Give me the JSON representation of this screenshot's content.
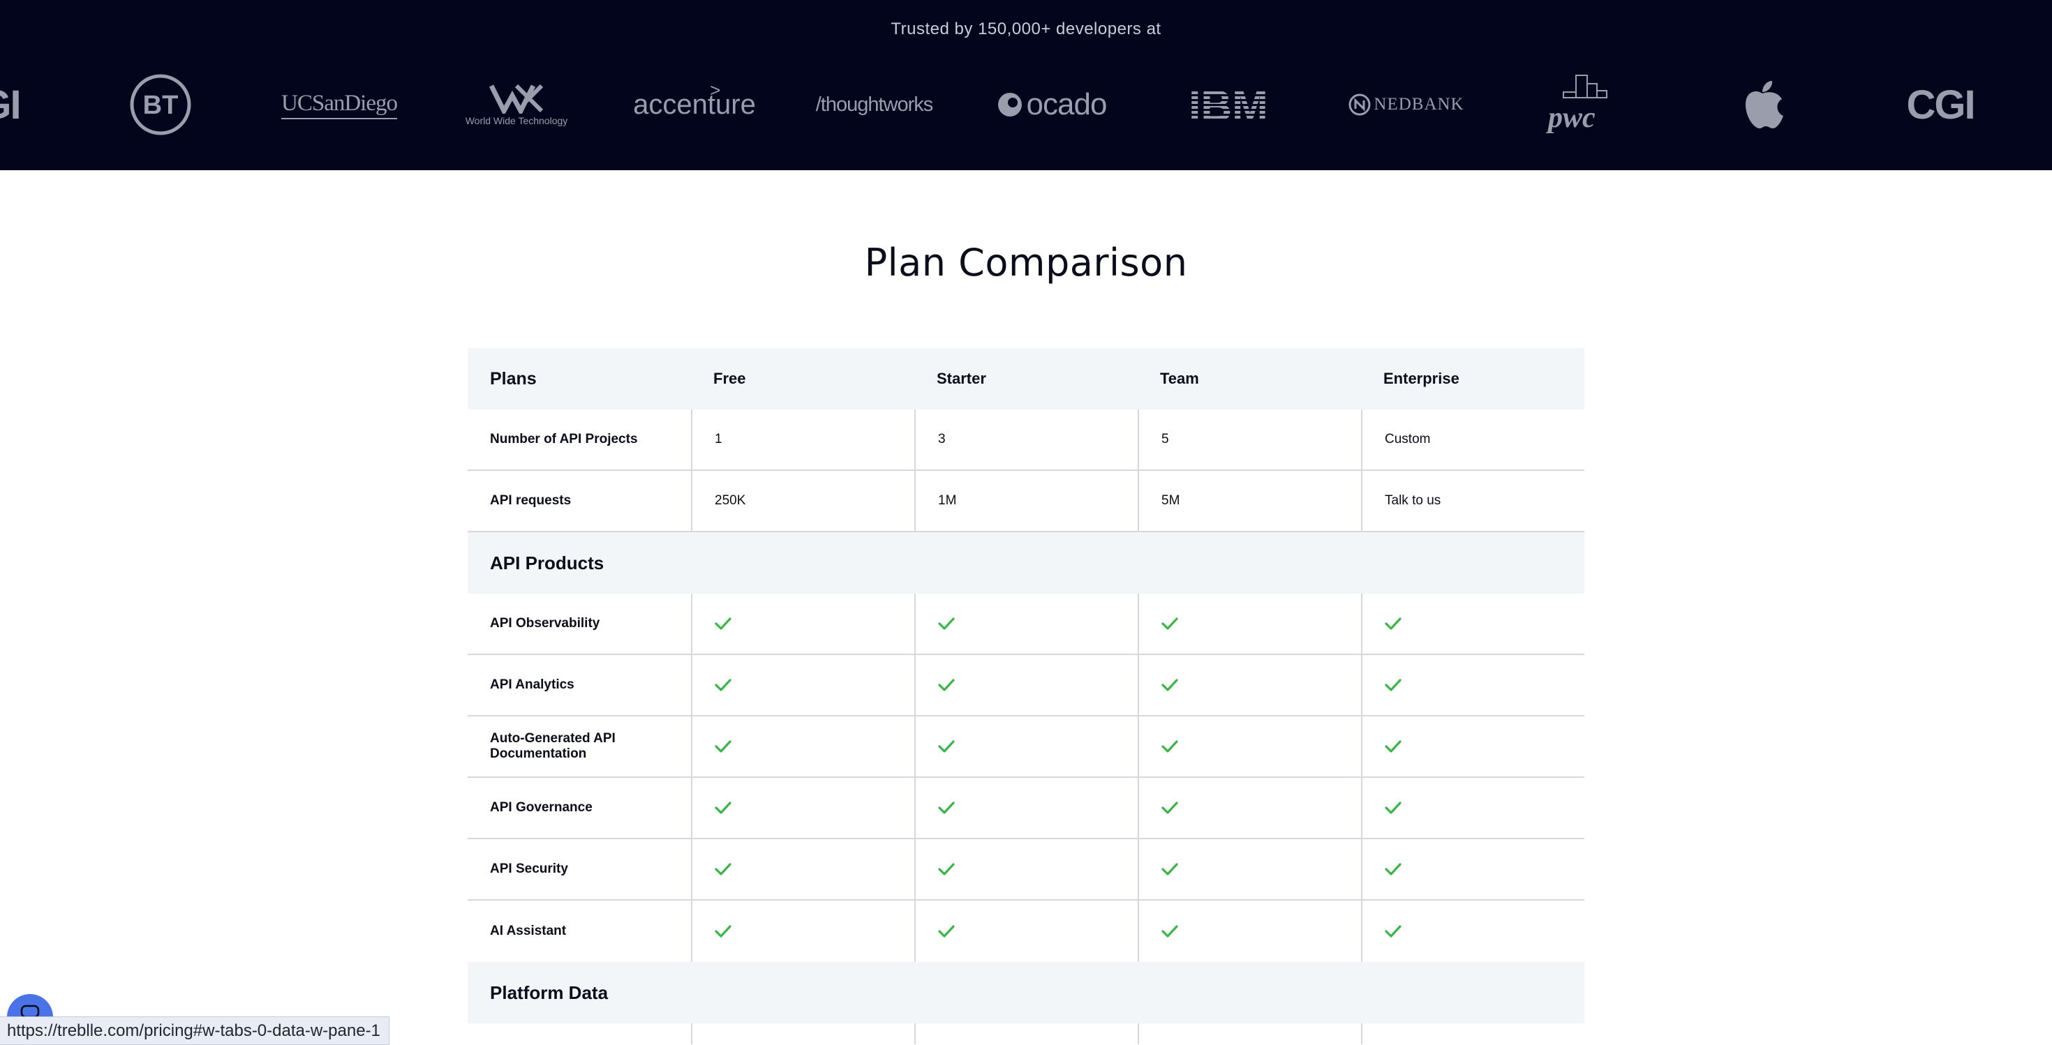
{
  "logo_band": {
    "trusted_text": "Trusted by 150,000+ developers at",
    "logos": [
      {
        "name": "CGI",
        "icon": "cgi-logo"
      },
      {
        "name": "BT",
        "icon": "bt-logo"
      },
      {
        "name": "UCSanDiego",
        "icon": "ucsd-logo"
      },
      {
        "name": "World Wide Technology",
        "icon": "wwt-logo"
      },
      {
        "name": "accenture",
        "icon": "accenture-logo"
      },
      {
        "name": "/thoughtworks",
        "icon": "thoughtworks-logo"
      },
      {
        "name": "ocado",
        "icon": "ocado-logo"
      },
      {
        "name": "IBM",
        "icon": "ibm-logo"
      },
      {
        "name": "NEDBANK",
        "icon": "nedbank-logo"
      },
      {
        "name": "pwc",
        "icon": "pwc-logo"
      },
      {
        "name": "Apple",
        "icon": "apple-logo"
      },
      {
        "name": "CGI",
        "icon": "cgi-logo"
      }
    ]
  },
  "page_title": "Plan Comparison",
  "table": {
    "headers": [
      "Plans",
      "Free",
      "Starter",
      "Team",
      "Enterprise"
    ],
    "rows": [
      {
        "label": "Number of API Projects",
        "values": [
          "1",
          "3",
          "5",
          "Custom"
        ]
      },
      {
        "label": "API requests",
        "values": [
          "250K",
          "1M",
          "5M",
          "Talk to us"
        ]
      }
    ],
    "sections": [
      {
        "title": "API Products",
        "features": [
          {
            "label": "API Observability",
            "included": [
              true,
              true,
              true,
              true
            ]
          },
          {
            "label": "API Analytics",
            "included": [
              true,
              true,
              true,
              true
            ]
          },
          {
            "label": "Auto-Generated API Documentation",
            "included": [
              true,
              true,
              true,
              true
            ]
          },
          {
            "label": "API Governance",
            "included": [
              true,
              true,
              true,
              true
            ]
          },
          {
            "label": "API Security",
            "included": [
              true,
              true,
              true,
              true
            ]
          },
          {
            "label": "AI Assistant",
            "included": [
              true,
              true,
              true,
              true
            ]
          }
        ]
      },
      {
        "title": "Platform Data",
        "features": []
      }
    ]
  },
  "status_bar": {
    "url": "https://treblle.com/pricing#w-tabs-0-data-w-pane-1"
  },
  "colors": {
    "band_bg": "#03051c",
    "logo_gray": "#9a9dab",
    "check_green": "#3bb54a",
    "header_row_bg": "#f3f6f9",
    "chat_bubble": "#4a73e8"
  }
}
